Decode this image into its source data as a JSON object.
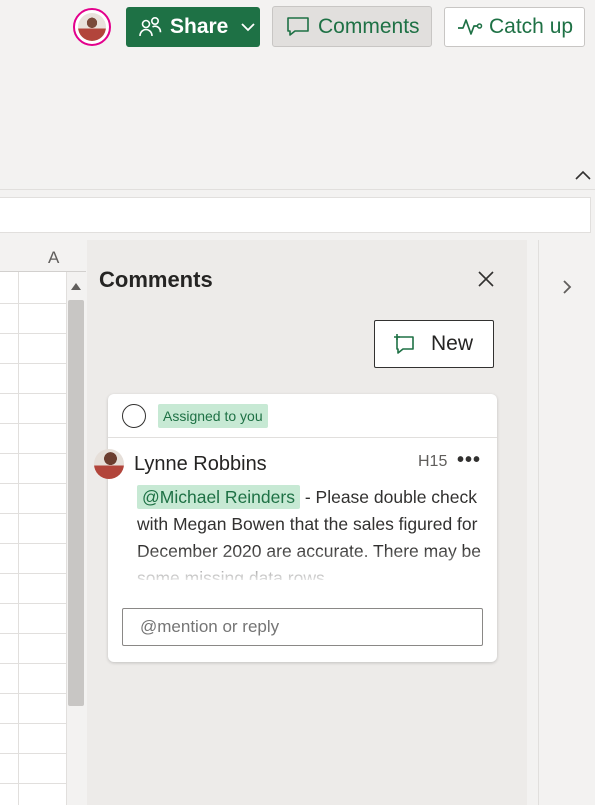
{
  "header": {
    "share_label": "Share",
    "comments_label": "Comments",
    "catchup_label": "Catch up"
  },
  "grid": {
    "column_a": "A"
  },
  "comments_pane": {
    "title": "Comments",
    "new_label": "New",
    "card": {
      "assigned_label": "Assigned to you",
      "author": "Lynne Robbins",
      "cell_ref": "H15",
      "more": "•••",
      "mention": "@Michael Reinders",
      "body_text": " - Please double check with Megan Bowen that the sales figured for December 2020 are accurate. There may be some missing data rows",
      "reply_placeholder": "@mention or reply"
    }
  },
  "colors": {
    "accent_green": "#1e7145",
    "mention_bg": "#c7e9d4",
    "avatar_ring": "#e3008c"
  }
}
